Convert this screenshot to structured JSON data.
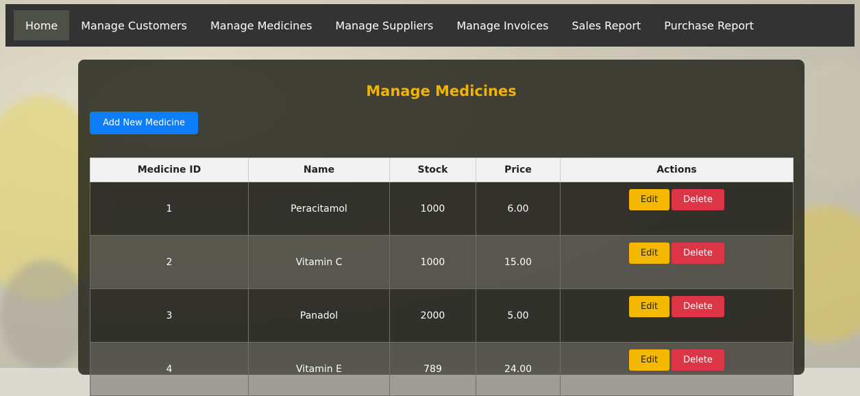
{
  "nav": {
    "items": [
      {
        "label": "Home",
        "active": true
      },
      {
        "label": "Manage Customers",
        "active": false
      },
      {
        "label": "Manage Medicines",
        "active": false
      },
      {
        "label": "Manage Suppliers",
        "active": false
      },
      {
        "label": "Manage Invoices",
        "active": false
      },
      {
        "label": "Sales Report",
        "active": false
      },
      {
        "label": "Purchase Report",
        "active": false
      }
    ]
  },
  "main": {
    "title": "Manage Medicines",
    "add_button": "Add New Medicine"
  },
  "table": {
    "columns": [
      "Medicine ID",
      "Name",
      "Stock",
      "Price",
      "Actions"
    ],
    "rows": [
      {
        "id": "1",
        "name": "Peracitamol",
        "stock": "1000",
        "price": "6.00"
      },
      {
        "id": "2",
        "name": "Vitamin C",
        "stock": "1000",
        "price": "15.00"
      },
      {
        "id": "3",
        "name": "Panadol",
        "stock": "2000",
        "price": "5.00"
      },
      {
        "id": "4",
        "name": "Vitamin E",
        "stock": "789",
        "price": "24.00"
      }
    ],
    "edit_label": "Edit",
    "delete_label": "Delete"
  },
  "colors": {
    "navbar": "#333333",
    "active_nav": "#4d5147",
    "title": "#f0b400",
    "add_button": "#0d7df9",
    "edit_button": "#f5b800",
    "delete_button": "#dc3545"
  }
}
